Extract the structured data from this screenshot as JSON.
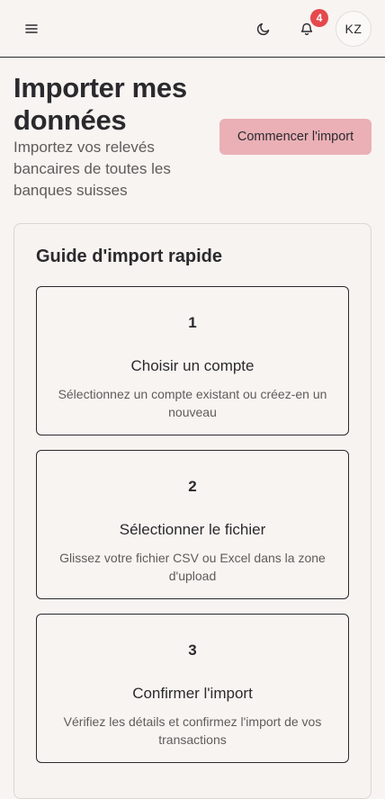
{
  "header": {
    "menu_icon": "hamburger-menu-icon",
    "theme_icon": "moon-icon",
    "notification_icon": "bell-icon",
    "notification_count": "4",
    "avatar_initials": "KZ"
  },
  "page": {
    "title": "Importer mes données",
    "subtitle": "Importez vos relevés bancaires de toutes les banques suisses",
    "start_button": "Commencer l'import"
  },
  "guide": {
    "title": "Guide d'import rapide",
    "steps": [
      {
        "number": "1",
        "title": "Choisir un compte",
        "description": "Sélectionnez un compte existant ou créez-en un nouveau"
      },
      {
        "number": "2",
        "title": "Sélectionner le fichier",
        "description": "Glissez votre fichier CSV ou Excel dans la zone d'upload"
      },
      {
        "number": "3",
        "title": "Confirmer l'import",
        "description": "Vérifiez les détails et confirmez l'import de vos transactions"
      }
    ]
  },
  "colors": {
    "background": "#f8f4f1",
    "accent_button": "#eab0b6",
    "badge": "#e5484d",
    "text": "#2a2a2e"
  }
}
